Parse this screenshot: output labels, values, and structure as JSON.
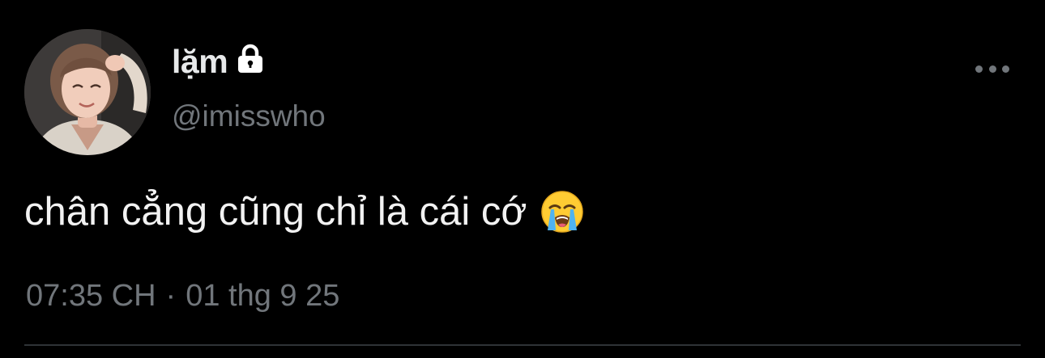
{
  "user": {
    "display_name": "lặm",
    "handle": "@imisswho",
    "protected_icon": "lock-icon",
    "avatar_icon": "profile-photo"
  },
  "tweet": {
    "text": "chân cẳng cũng chỉ là cái cớ",
    "emoji": "loudly-crying-face",
    "time": "07:35 CH",
    "separator": "·",
    "date": "01 thg 9 25"
  },
  "actions": {
    "more_icon": "more-horizontal-icon"
  },
  "colors": {
    "background": "#000000",
    "primary_text": "#e7e9ea",
    "secondary_text": "#71767b",
    "divider": "#2f3336"
  }
}
